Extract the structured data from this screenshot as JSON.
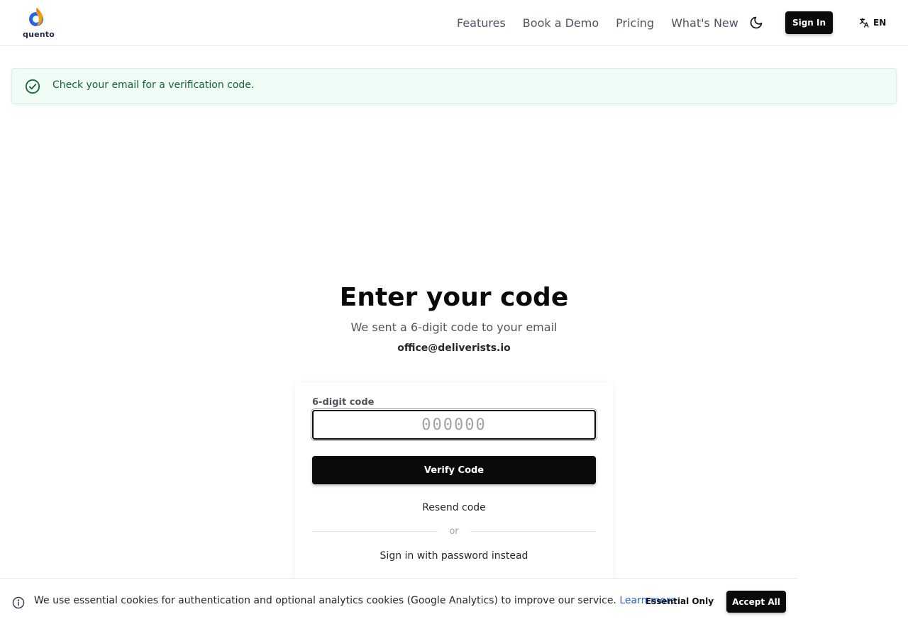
{
  "header": {
    "logo_text": "quento",
    "nav": [
      {
        "label": "Features"
      },
      {
        "label": "Book a Demo"
      },
      {
        "label": "Pricing"
      },
      {
        "label": "What's New"
      }
    ],
    "theme_toggle_icon": "moon-icon",
    "sign_in_label": "Sign In",
    "language_icon": "translate-icon",
    "language_label": "EN"
  },
  "alert": {
    "icon": "check-circle-icon",
    "message": "Check your email for a verification code.",
    "color": "#166534"
  },
  "main": {
    "title": "Enter your code",
    "subtitle": "We sent a 6-digit code to your email",
    "email": "office@deliverists.io"
  },
  "form": {
    "code_label": "6-digit code",
    "code_placeholder": "000000",
    "code_value": "",
    "verify_label": "Verify Code",
    "resend_label": "Resend code",
    "divider_label": "or",
    "password_link_label": "Sign in with password instead"
  },
  "cookie_banner": {
    "icon": "info-icon",
    "message": "We use essential cookies for authentication and optional analytics cookies (Google Analytics) to improve our service.",
    "learn_more_label": "Learn more",
    "essential_label": "Essential Only",
    "accept_label": "Accept All",
    "link_color": "#2563eb"
  }
}
